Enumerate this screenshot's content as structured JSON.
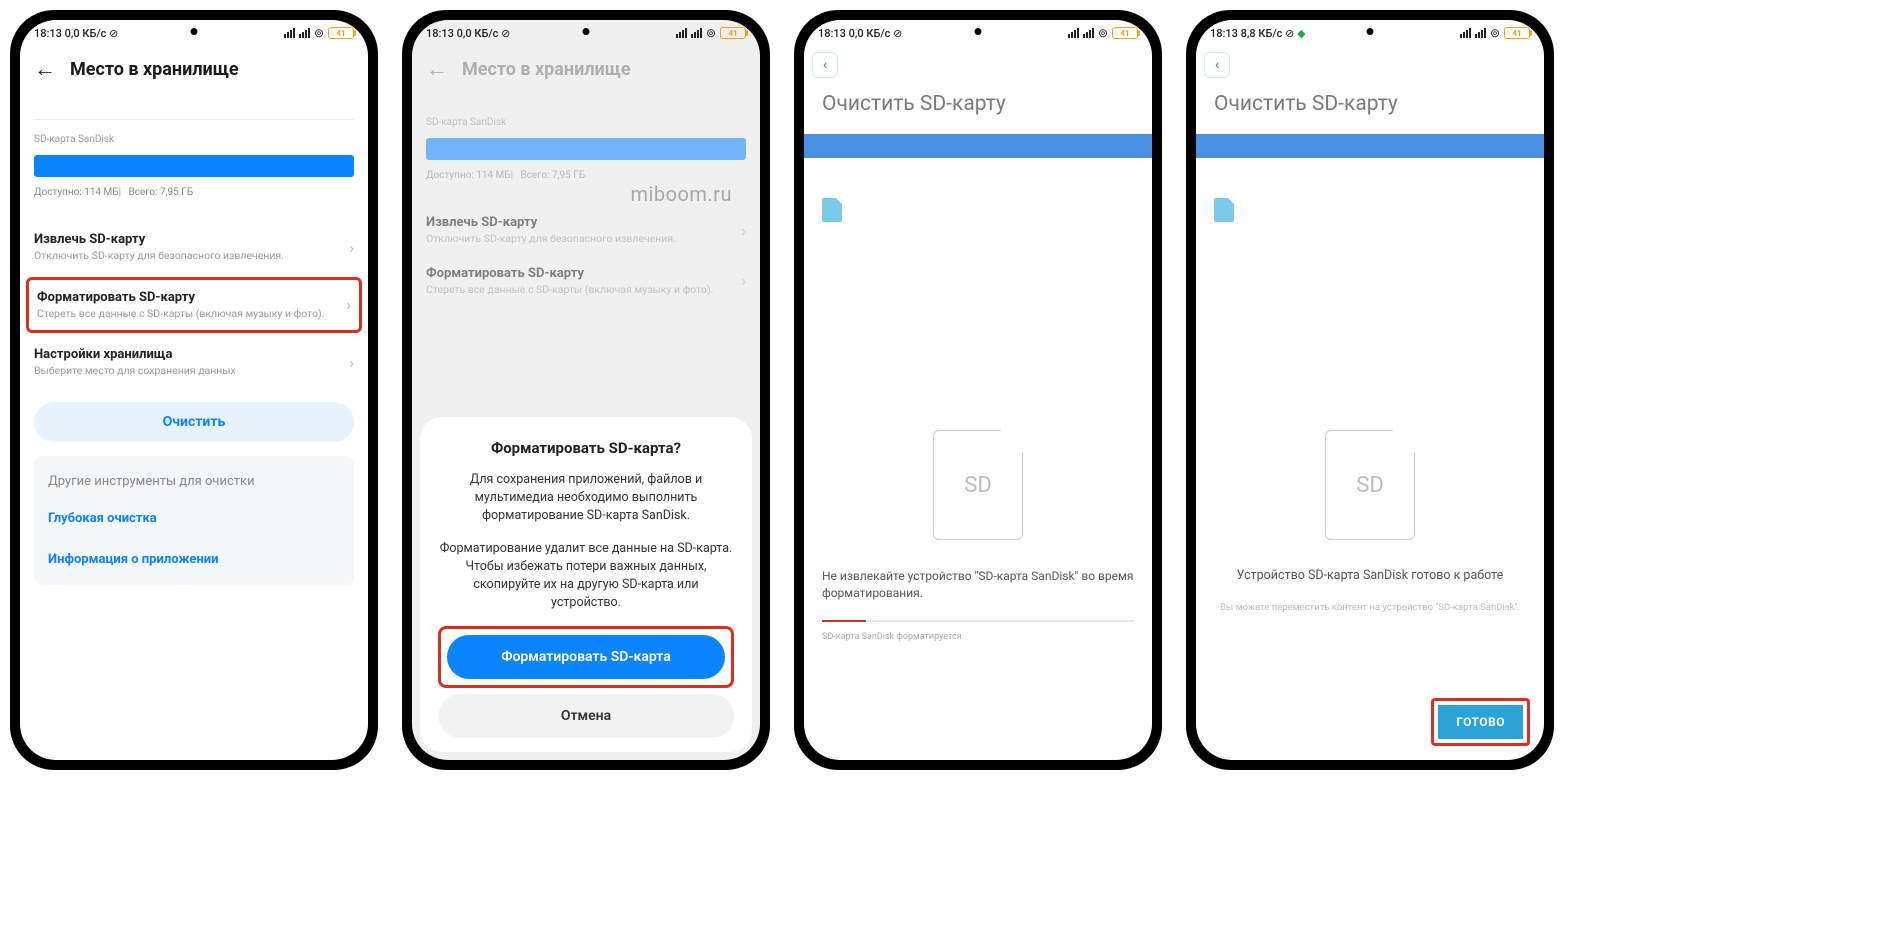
{
  "status": {
    "time": "18:13",
    "speed1": "0,0 КБ/с",
    "speed4": "8,8 КБ/с",
    "battery": "41"
  },
  "watermark": "miboom.ru",
  "s1": {
    "title": "Место в хранилище",
    "truncated": "· -,- - · -",
    "sd_label": "SD-карта SanDisk",
    "avail": "Доступно: 114 МБ|",
    "total": "Всего: 7,95 ГБ",
    "opt_eject_t": "Извлечь SD-карту",
    "opt_eject_s": "Отключить SD-карту для безопасного извлечения.",
    "opt_format_t": "Форматировать SD-карту",
    "opt_format_s": "Стереть все данные с SD-карты (включая музыку и фото).",
    "opt_settings_t": "Настройки хранилища",
    "opt_settings_s": "Выберите место для сохранения данных",
    "clean_btn": "Очистить",
    "footer_h": "Другие инструменты для очистки",
    "footer_l1": "Глубокая очистка",
    "footer_l2": "Информация о приложении"
  },
  "s2": {
    "dialog_title": "Форматировать SD-карта?",
    "dialog_p1": "Для сохранения приложений, файлов и мультимедиа необходимо выполнить форматирование SD-карта SanDisk.",
    "dialog_p2": "Форматирование удалит все данные на SD-карта. Чтобы избежать потери важных данных, скопируйте их на другую SD-карта или устройство.",
    "dialog_primary": "Форматировать SD-карта",
    "dialog_cancel": "Отмена"
  },
  "s3": {
    "title": "Очистить SD-карту",
    "sd_text": "SD",
    "info": "Не извлекайте устройство \"SD-карта SanDisk\" во время форматирования.",
    "progress_label": "SD-карта SanDisk форматируется"
  },
  "s4": {
    "title": "Очистить SD-карту",
    "sd_text": "SD",
    "done_text": "Устройство SD-карта SanDisk готово к работе",
    "sub_text": "Вы можете переместить контент на устройство \"SD-карта SanDisk\".",
    "done_btn": "ГОТОВО"
  }
}
